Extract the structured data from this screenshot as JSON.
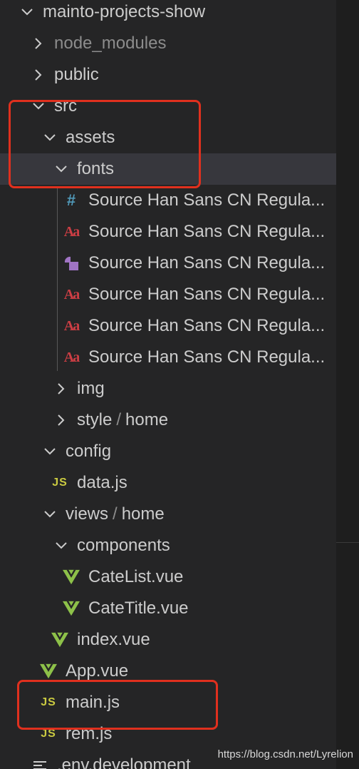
{
  "explorer": {
    "project_root": "mainto-projects-show",
    "node_modules": "node_modules",
    "public": "public",
    "src": "src",
    "assets": "assets",
    "fonts": "fonts",
    "font_files": [
      {
        "name": "Source Han Sans CN Regula...",
        "icon": "hash-icon"
      },
      {
        "name": "Source Han Sans CN Regula...",
        "icon": "font-file-icon"
      },
      {
        "name": "Source Han Sans CN Regula...",
        "icon": "shape-file-icon"
      },
      {
        "name": "Source Han Sans CN Regula...",
        "icon": "font-file-icon"
      },
      {
        "name": "Source Han Sans CN Regula...",
        "icon": "font-file-icon"
      },
      {
        "name": "Source Han Sans CN Regula...",
        "icon": "font-file-icon"
      }
    ],
    "img": "img",
    "style": "style",
    "style_sub": "home",
    "path_sep": "/",
    "config": "config",
    "data_js": "data.js",
    "views": "views",
    "views_sub": "home",
    "components": "components",
    "catelist": "CateList.vue",
    "catetitle": "CateTitle.vue",
    "index_vue": "index.vue",
    "app_vue": "App.vue",
    "main_js": "main.js",
    "rem_js": "rem.js",
    "env_dev": ".env.development",
    "js_badge": "JS"
  },
  "watermark": "https://blog.csdn.net/Lyrelion",
  "colors": {
    "background": "#252526",
    "selected_row": "#37373d",
    "highlight_box": "#e0301e",
    "js_yellow": "#cbcb41",
    "vue_green": "#8dc149",
    "font_red": "#cc3e44",
    "css_blue": "#519aba",
    "purple": "#a074c4"
  }
}
